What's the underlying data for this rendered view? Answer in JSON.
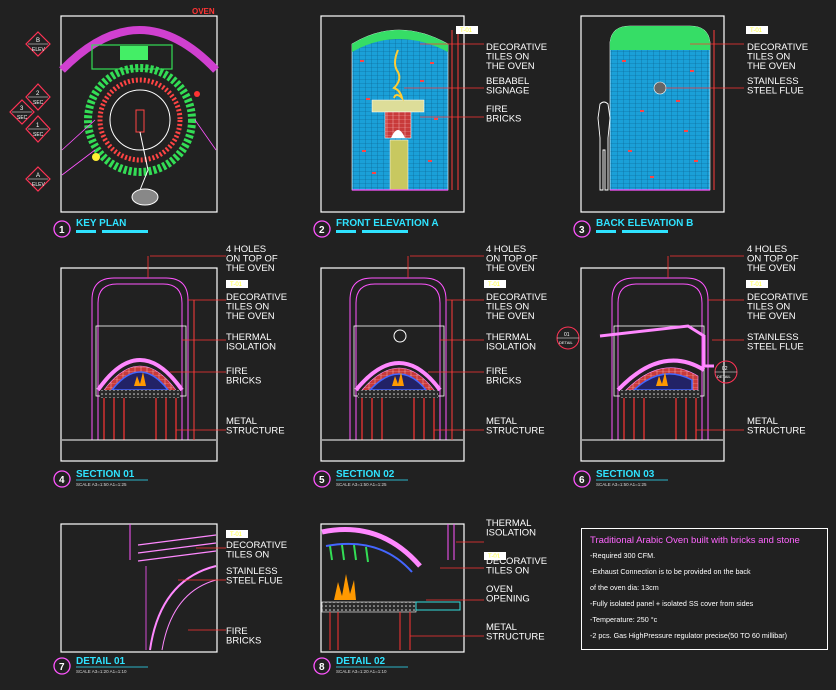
{
  "sheet": {
    "oven_label": "OVEN"
  },
  "markers": {
    "elev_b": {
      "letter": "B",
      "code": "ELEV"
    },
    "elev_a": {
      "letter": "A",
      "code": "ELEV"
    },
    "sec_2": {
      "letter": "2",
      "code": "SEC"
    },
    "sec_3": {
      "letter": "3",
      "code": "SEC"
    },
    "sec_1": {
      "letter": "1",
      "code": "SEC"
    },
    "detail_01": {
      "letter": "01",
      "code": "DETAIL"
    },
    "detail_02": {
      "letter": "02",
      "code": "DETAIL"
    }
  },
  "views": {
    "v1": {
      "num": "1",
      "title": "KEY PLAN",
      "scale": ""
    },
    "v2": {
      "num": "2",
      "title": "FRONT ELEVATION A",
      "scale": ""
    },
    "v3": {
      "num": "3",
      "title": "BACK ELEVATION B",
      "scale": ""
    },
    "v4": {
      "num": "4",
      "title": "SECTION 01",
      "scale": "SCALE    A3=1:50  A1=1:25"
    },
    "v5": {
      "num": "5",
      "title": "SECTION 02",
      "scale": "SCALE    A3=1:50  A1=1:25"
    },
    "v6": {
      "num": "6",
      "title": "SECTION 03",
      "scale": "SCALE    A3=1:50  A1=1:25"
    },
    "v7": {
      "num": "7",
      "title": "DETAIL 01",
      "scale": "SCALE    A3=1:20  A1=1:10"
    },
    "v8": {
      "num": "8",
      "title": "DETAIL 02",
      "scale": "SCALE    A3=1:20  A1=1:10"
    }
  },
  "tags": {
    "t2": "T-01",
    "t3": "T-01",
    "t4": "T-01",
    "t5": "T-01",
    "t6": "T-01",
    "t7": "T-01",
    "t8": "T-01"
  },
  "labels": {
    "front": [
      [
        "DECORATIVE",
        "TILES ON",
        "THE OVEN"
      ],
      [
        "BEBABEL",
        "SIGNAGE"
      ],
      [
        "FIRE",
        "BRICKS"
      ]
    ],
    "back": [
      [
        "DECORATIVE",
        "TILES ON",
        "THE OVEN"
      ],
      [
        "STAINLESS",
        "STEEL FLUE"
      ]
    ],
    "sec1": [
      [
        "4 HOLES",
        "ON TOP OF",
        "THE OVEN"
      ],
      [
        "DECORATIVE",
        "TILES ON",
        "THE OVEN"
      ],
      [
        "THERMAL",
        "ISOLATION"
      ],
      [
        "FIRE",
        "BRICKS"
      ],
      [
        "METAL",
        "STRUCTURE"
      ]
    ],
    "sec2": [
      [
        "4 HOLES",
        "ON TOP OF",
        "THE OVEN"
      ],
      [
        "DECORATIVE",
        "TILES ON",
        "THE OVEN"
      ],
      [
        "THERMAL",
        "ISOLATION"
      ],
      [
        "FIRE",
        "BRICKS"
      ],
      [
        "METAL",
        "STRUCTURE"
      ]
    ],
    "sec3": [
      [
        "4 HOLES",
        "ON TOP OF",
        "THE OVEN"
      ],
      [
        "DECORATIVE",
        "TILES ON",
        "THE OVEN"
      ],
      [
        "STAINLESS",
        "STEEL FLUE"
      ],
      [
        "METAL",
        "STRUCTURE"
      ]
    ],
    "det1": [
      [
        "DECORATIVE",
        "TILES ON"
      ],
      [
        "STAINLESS",
        "STEEL FLUE"
      ],
      [
        "FIRE",
        "BRICKS"
      ]
    ],
    "det2": [
      [
        "THERMAL",
        "ISOLATION"
      ],
      [
        "DECORATIVE",
        "TILES ON"
      ],
      [
        "OVEN",
        "OPENING"
      ],
      [
        "METAL",
        "STRUCTURE"
      ]
    ]
  },
  "notes": {
    "title": "Traditional Arabic Oven built with bricks and stone",
    "items": [
      "-Required 300 CFM.",
      "-Exhaust Connection is to be provided on the back",
      "of the oven dia: 13cm",
      "-Fully isolated panel + isolated SS cover from sides",
      "-Temperature: 250 °c",
      "-2 pcs. Gas HighPressure regulator precise(50 TO 60 millibar)"
    ]
  }
}
